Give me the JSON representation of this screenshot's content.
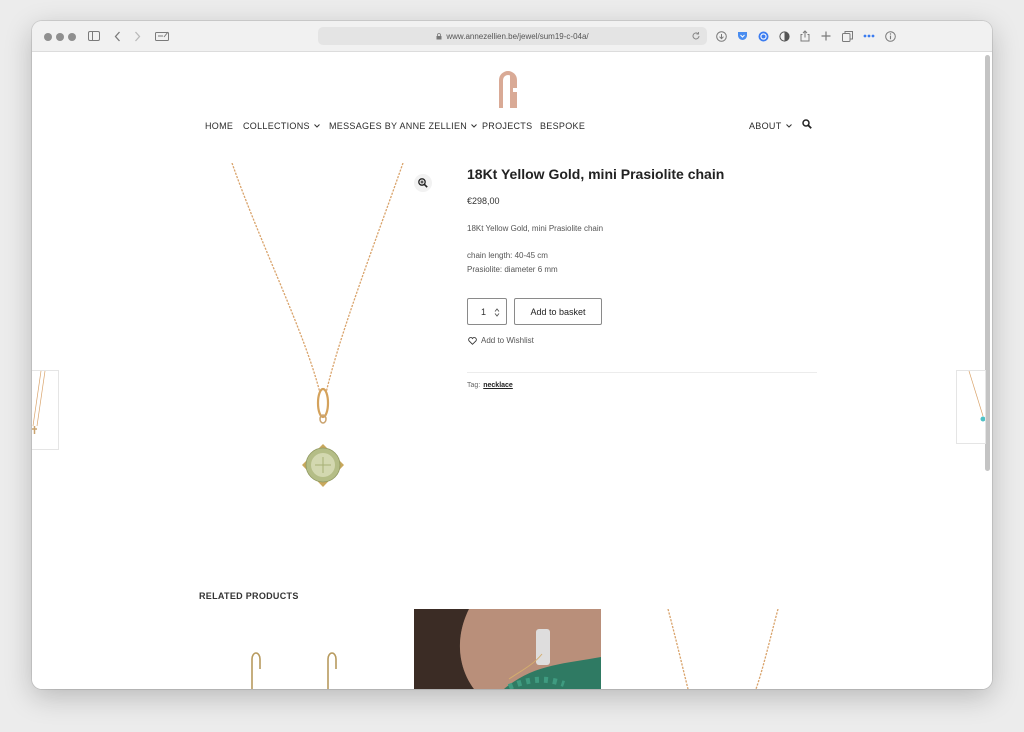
{
  "browser": {
    "url": "www.annezellien.be/jewel/sum19-c-04a/"
  },
  "nav": {
    "home": "HOME",
    "collections": "COLLECTIONS",
    "messages": "MESSAGES BY ANNE ZELLIEN",
    "projects": "PROJECTS",
    "bespoke": "BESPOKE",
    "about": "ABOUT"
  },
  "product": {
    "title": "18Kt Yellow Gold, mini Prasiolite chain",
    "price": "€298,00",
    "description": "18Kt Yellow Gold, mini Prasiolite chain",
    "chain_length": "chain length: 40-45 cm",
    "prasiolite": "Prasiolite: diameter 6 mm",
    "quantity": "1",
    "add_to_basket": "Add to basket",
    "add_to_wishlist": "Add to Wishlist",
    "tag_label": "Tag:",
    "tag": "necklace"
  },
  "related": {
    "title": "RELATED PRODUCTS"
  },
  "icons": {
    "logo": "anne-zellien-logo",
    "search": "search-icon",
    "zoom": "zoom-in-icon",
    "wishlist": "heart-icon"
  },
  "colors": {
    "logo": "#d9aa96",
    "gold": "#d9a36b",
    "stone": "#b4bd86",
    "text": "#333333"
  }
}
